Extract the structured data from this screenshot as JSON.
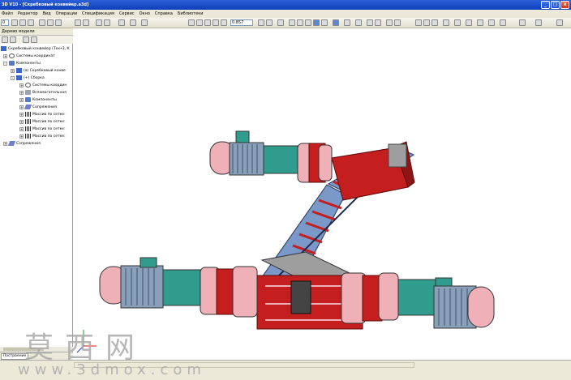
{
  "window": {
    "title": "3D V10 - [Скребковый конвейер.a3d]",
    "buttons": [
      "_",
      "□",
      "x"
    ]
  },
  "menu": [
    "Файл",
    "Редактор",
    "Вид",
    "Операции",
    "Спецификация",
    "Сервис",
    "Окно",
    "Справка",
    "Библиотеки"
  ],
  "toolbar": {
    "zoom_value": "0.857",
    "left_field": "0"
  },
  "model_tree": {
    "title": "Дерево модели",
    "nodes": [
      {
        "label": "Скребковый конвейер (Тех•3, К",
        "exp": ""
      },
      {
        "label": "Системы координат",
        "exp": "+"
      },
      {
        "label": "Компоненты",
        "exp": "-"
      },
      {
        "label": "(a) Скребковый конве",
        "exp": "+"
      },
      {
        "label": "(+) Сборка",
        "exp": "-"
      },
      {
        "label": "Системы координ",
        "exp": "+"
      },
      {
        "label": "Вспомогательная",
        "exp": "+"
      },
      {
        "label": "Компоненты",
        "exp": "+"
      },
      {
        "label": "Сопряжения",
        "exp": "+"
      },
      {
        "label": "Массив по сетке:",
        "exp": "+"
      },
      {
        "label": "Массив по сетке:",
        "exp": "+"
      },
      {
        "label": "Массив по сетке:",
        "exp": "+"
      },
      {
        "label": "Массив по сетке:",
        "exp": "+"
      },
      {
        "label": "Сопряжения",
        "exp": "+"
      }
    ],
    "tab_label": "Построение"
  },
  "watermark": {
    "chinese": "莫西网",
    "url": "www.3dmox.com"
  },
  "colors": {
    "frame_red": "#c41e1e",
    "pink": "#f0b0b8",
    "teal": "#2f9c8e",
    "steel_blue": "#7a98c8",
    "motor_gray": "#8aa0b8"
  }
}
